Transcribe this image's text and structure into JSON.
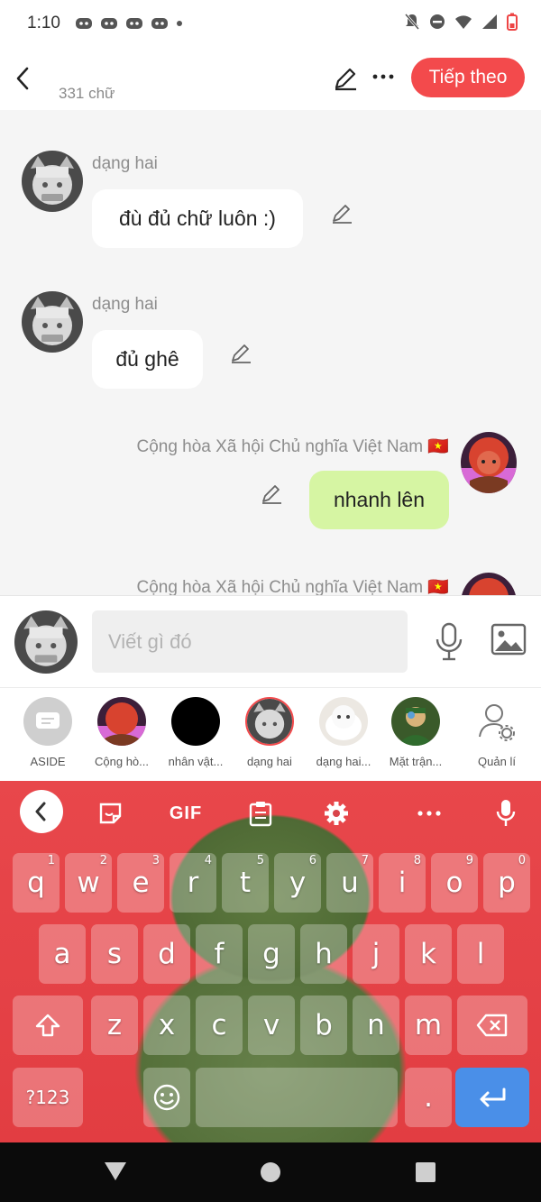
{
  "status_bar": {
    "time": "1:10"
  },
  "top_bar": {
    "word_count": "331 chữ",
    "next_label": "Tiếp theo"
  },
  "messages": [
    {
      "sender": "dạng hai",
      "text": "đù đủ chữ luôn :)",
      "side": "left"
    },
    {
      "sender": "dạng hai",
      "text": "đủ ghê",
      "side": "left"
    },
    {
      "sender": "Cộng hòa Xã hội Chủ nghĩa Việt Nam 🇻🇳",
      "text": "nhanh lên",
      "side": "right"
    },
    {
      "sender": "Cộng hòa Xã hội Chủ nghĩa Việt Nam 🇻🇳",
      "text": "",
      "side": "right"
    }
  ],
  "input": {
    "placeholder": "Viết gì đó"
  },
  "characters": [
    {
      "label": "ASIDE"
    },
    {
      "label": "Cộng hò..."
    },
    {
      "label": "nhân vật..."
    },
    {
      "label": "dạng hai"
    },
    {
      "label": "dạng hai..."
    },
    {
      "label": "Mặt trận..."
    },
    {
      "label": "Quản lí"
    }
  ],
  "keyboard": {
    "gif_label": "GIF",
    "row1": [
      {
        "k": "q",
        "h": "1"
      },
      {
        "k": "w",
        "h": "2"
      },
      {
        "k": "e",
        "h": "3"
      },
      {
        "k": "r",
        "h": "4"
      },
      {
        "k": "t",
        "h": "5"
      },
      {
        "k": "y",
        "h": "6"
      },
      {
        "k": "u",
        "h": "7"
      },
      {
        "k": "i",
        "h": "8"
      },
      {
        "k": "o",
        "h": "9"
      },
      {
        "k": "p",
        "h": "0"
      }
    ],
    "row2": [
      "a",
      "s",
      "d",
      "f",
      "g",
      "h",
      "j",
      "k",
      "l"
    ],
    "row3": [
      "z",
      "x",
      "c",
      "v",
      "b",
      "n",
      "m"
    ],
    "symbols_label": "?123",
    "period": "."
  },
  "colors": {
    "accent": "#f34a4c",
    "bubble_self": "#d6f5a3",
    "enter_key": "#4a8fe8"
  }
}
